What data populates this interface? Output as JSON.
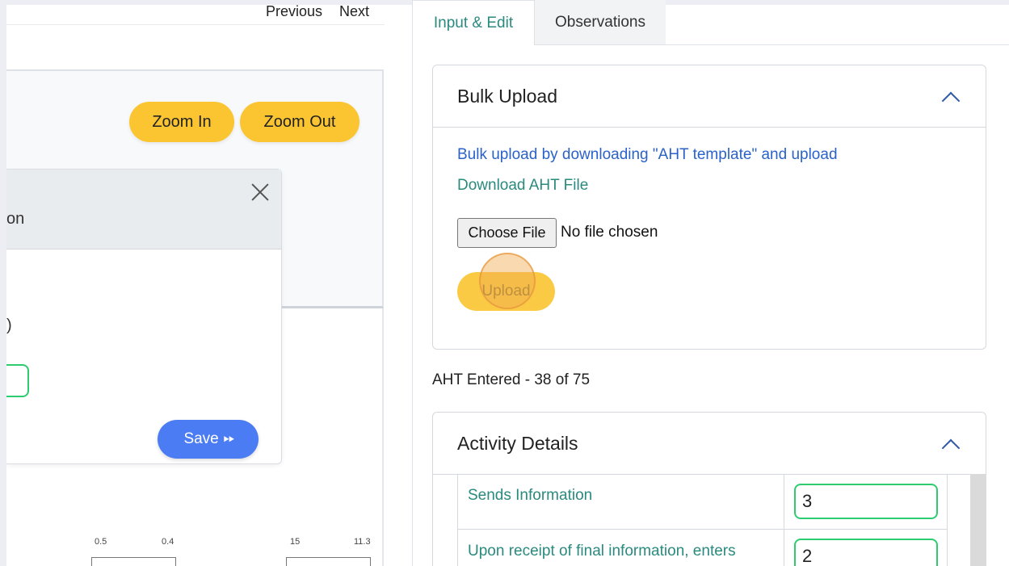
{
  "nav": {
    "previous": "Previous",
    "next": "Next"
  },
  "viewer": {
    "zoom_in": "Zoom In",
    "zoom_out": "Zoom Out"
  },
  "modal": {
    "title_fragment": "on",
    "paren_fragment": ")",
    "save_label": "Save",
    "save_icon": "⯈⯈"
  },
  "axis_ticks": [
    "0.5",
    "0.4",
    "15",
    "11.3"
  ],
  "tabs": [
    {
      "label": "Input & Edit",
      "active": true
    },
    {
      "label": "Observations",
      "active": false
    }
  ],
  "bulk_upload": {
    "title": "Bulk Upload",
    "description_link": "Bulk upload by downloading \"AHT template\" and upload",
    "download_link": "Download AHT File",
    "choose_file_label": "Choose File",
    "no_file_text": "No file chosen",
    "upload_label": "Upload"
  },
  "aht_status": "AHT Entered - 38 of 75",
  "activity_details": {
    "title": "Activity Details",
    "rows": [
      {
        "label": "Sends Information",
        "value": "3"
      },
      {
        "label": "Upon receipt of final information, enters",
        "value": "2"
      }
    ]
  },
  "colors": {
    "accent_yellow": "#fbc531",
    "primary_blue": "#4c7cf3",
    "teal": "#2a8a7e",
    "link_blue": "#2a62c9",
    "success_green": "#2ecc71"
  }
}
